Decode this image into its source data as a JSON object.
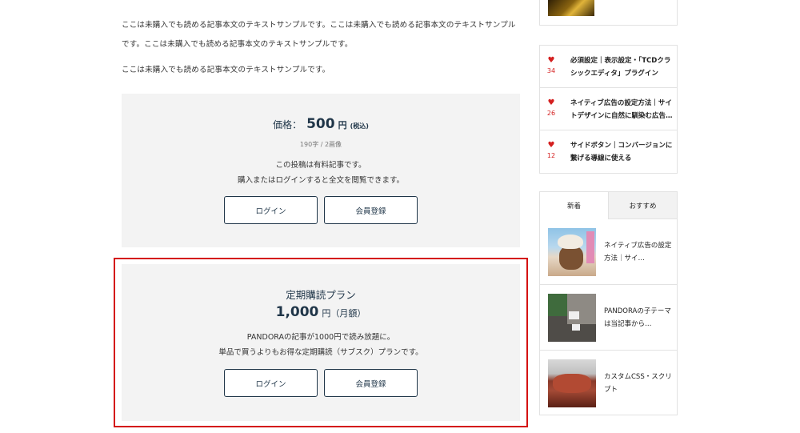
{
  "article": {
    "paragraph1": "ここは未購入でも読める記事本文のテキストサンプルです。ここは未購入でも読める記事本文のテキストサンプルです。ここは未購入でも読める記事本文のテキストサンプルです。",
    "paragraph2": "ここは未購入でも読める記事本文のテキストサンプルです。"
  },
  "paywall": {
    "price_label": "価格：",
    "price_value": "500",
    "price_unit": "円",
    "tax_note": "(税込)",
    "meta": "190字 / 2画像",
    "notice_line1": "この投稿は有料記事です。",
    "notice_line2": "購入またはログインすると全文を閲覧できます。",
    "login_label": "ログイン",
    "register_label": "会員登録"
  },
  "subscription": {
    "title": "定期購読プラン",
    "price_value": "1,000",
    "price_unit": "円（月額）",
    "desc_line1": "PANDORAの記事が1000円で読み放題に。",
    "desc_line2": "単品で買うよりもお得な定期購読（サブスク）プランです。",
    "login_label": "ログイン",
    "register_label": "会員登録"
  },
  "sidebar": {
    "ranking": [
      {
        "likes": "34",
        "title": "必須設定｜表示設定・「TCDクラシックエディタ」プラグイン",
        "heart": "heart-icon"
      },
      {
        "likes": "26",
        "title": "ネイティブ広告の設定方法｜サイトデザインに自然に馴染む広告…",
        "heart": "heart-icon"
      },
      {
        "likes": "12",
        "title": "サイドボタン｜コンバージョンに繋げる導線に使える",
        "heart": "heart-icon"
      }
    ],
    "tabs": [
      "新着",
      "おすすめ"
    ],
    "posts": [
      {
        "title": "ネイティブ広告の設定方法｜サイ…"
      },
      {
        "title": "PANDORAの子テーマは当記事から…"
      },
      {
        "title": "カスタムCSS・スクリプト"
      }
    ]
  },
  "colors": {
    "accent": "#1f3548",
    "highlight_border": "#d41212",
    "heart": "#d41f1f",
    "box_background": "#f3f3f3"
  }
}
